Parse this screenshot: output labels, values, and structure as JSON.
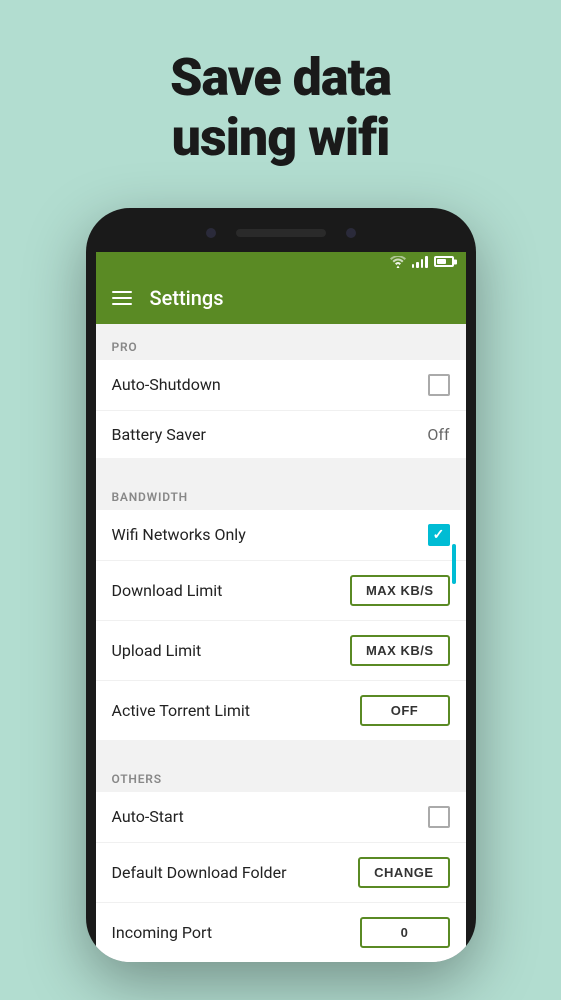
{
  "hero": {
    "line1": "Save data",
    "line2": "using wifi"
  },
  "status_bar": {
    "icons": [
      "wifi",
      "signal",
      "battery"
    ]
  },
  "app_bar": {
    "title": "Settings"
  },
  "sections": [
    {
      "id": "pro",
      "header": "PRO",
      "items": [
        {
          "id": "auto-shutdown",
          "label": "Auto-Shutdown",
          "control_type": "checkbox",
          "checked": false
        },
        {
          "id": "battery-saver",
          "label": "Battery Saver",
          "control_type": "value",
          "value": "Off"
        }
      ]
    },
    {
      "id": "bandwidth",
      "header": "BANDWIDTH",
      "items": [
        {
          "id": "wifi-networks-only",
          "label": "Wifi Networks Only",
          "control_type": "checkbox",
          "checked": true
        },
        {
          "id": "download-limit",
          "label": "Download Limit",
          "control_type": "button",
          "button_label": "MAX KB/S"
        },
        {
          "id": "upload-limit",
          "label": "Upload Limit",
          "control_type": "button",
          "button_label": "MAX KB/S"
        },
        {
          "id": "active-torrent-limit",
          "label": "Active Torrent Limit",
          "control_type": "button",
          "button_label": "OFF"
        }
      ]
    },
    {
      "id": "others",
      "header": "OTHERS",
      "items": [
        {
          "id": "auto-start",
          "label": "Auto-Start",
          "control_type": "checkbox",
          "checked": false
        },
        {
          "id": "default-download-folder",
          "label": "Default Download Folder",
          "control_type": "button",
          "button_label": "CHANGE"
        },
        {
          "id": "incoming-port",
          "label": "Incoming Port",
          "control_type": "button",
          "button_label": "0"
        }
      ]
    }
  ]
}
